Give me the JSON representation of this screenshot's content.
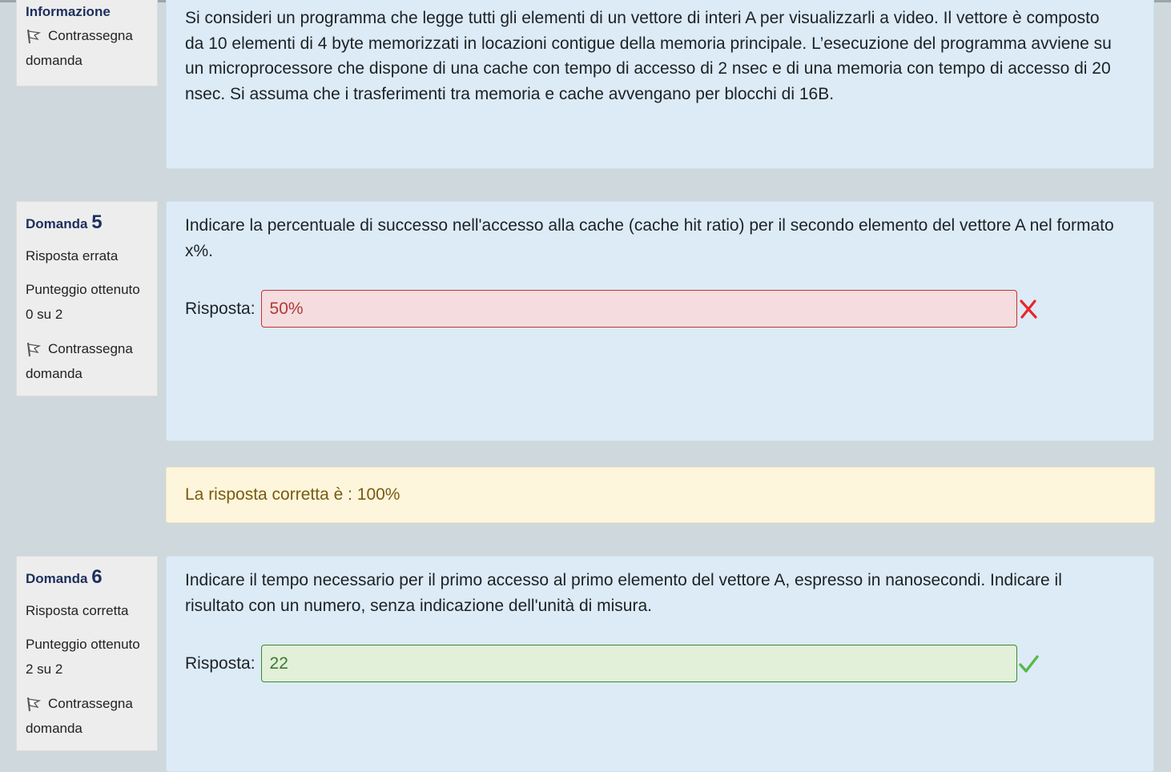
{
  "info_block": {
    "title": "Informazione",
    "flag_label_1": "Contrassegna",
    "flag_label_2": "domanda",
    "text": "Si consideri un programma che legge tutti gli elementi di un vettore di interi A per visualizzarli a video. Il vettore è composto da 10 elementi di 4 byte memorizzati in locazioni contigue della memoria principale. L’esecuzione del programma avviene su un microprocessore che dispone di una cache con tempo di accesso di 2 nsec e di una memoria con tempo di accesso di 20 nsec. Si assuma che i trasferimenti tra memoria e cache avvengano per blocchi di 16B."
  },
  "questions": [
    {
      "label": "Domanda",
      "number": "5",
      "status": "Risposta errata",
      "score_label": "Punteggio ottenuto",
      "score": "0 su 2",
      "flag_label_1": "Contrassegna",
      "flag_label_2": "domanda",
      "text": "Indicare la percentuale di successo nell'accesso alla cache (cache hit ratio) per il secondo elemento del vettore A nel formato x%.",
      "answer_label": "Risposta:",
      "answer_value": "50%",
      "result_icon": "cross-icon",
      "result_color": "#e8262c",
      "feedback": "La risposta corretta è : 100%"
    },
    {
      "label": "Domanda",
      "number": "6",
      "status": "Risposta corretta",
      "score_label": "Punteggio ottenuto",
      "score": "2 su 2",
      "flag_label_1": "Contrassegna",
      "flag_label_2": "domanda",
      "text": "Indicare il tempo necessario per il primo accesso al primo elemento del vettore A, espresso in nanosecondi. Indicare il risultato con un numero, senza indicazione dell'unità di misura.",
      "answer_label": "Risposta:",
      "answer_value": "22",
      "result_icon": "check-icon",
      "result_color": "#58b947"
    }
  ],
  "colors": {
    "page_bg": "#cfd8dc",
    "content_bg": "#dcebf6",
    "info_bg": "#ededed",
    "feedback_bg": "#fdf6dc",
    "wrong_border": "#c9302c",
    "right_border": "#3a8a2e"
  }
}
